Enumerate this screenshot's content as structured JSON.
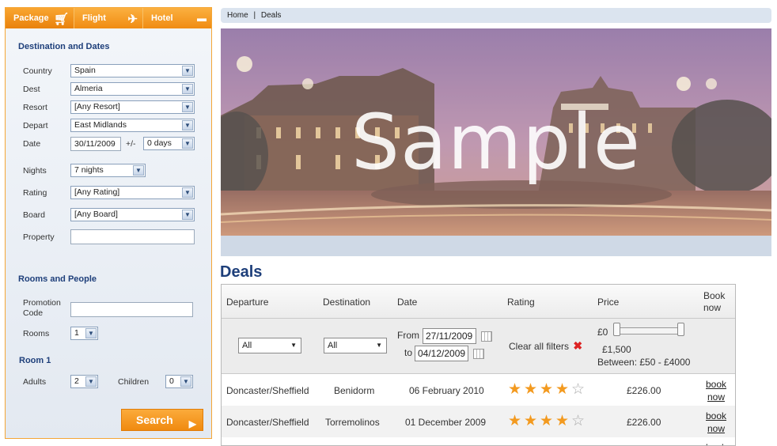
{
  "tabs": [
    {
      "label": "Package",
      "icon": "cart-icon"
    },
    {
      "label": "Flight",
      "icon": "plane-icon"
    },
    {
      "label": "Hotel",
      "icon": "bed-icon"
    }
  ],
  "search": {
    "section_dest": "Destination and Dates",
    "country_label": "Country",
    "country_value": "Spain",
    "dest_label": "Dest",
    "dest_value": "Almeria",
    "resort_label": "Resort",
    "resort_value": "[Any Resort]",
    "depart_label": "Depart",
    "depart_value": "East Midlands",
    "date_label": "Date",
    "date_value": "30/11/2009",
    "plusminus": "+/-",
    "flex_value": "0 days",
    "nights_label": "Nights",
    "nights_value": "7 nights",
    "rating_label": "Rating",
    "rating_value": "[Any Rating]",
    "board_label": "Board",
    "board_value": "[Any Board]",
    "property_label": "Property",
    "property_value": "",
    "section_rooms": "Rooms and People",
    "promo_label": "Promotion Code",
    "promo_value": "",
    "rooms_label": "Rooms",
    "rooms_value": "1",
    "room1_title": "Room 1",
    "adults_label": "Adults",
    "adults_value": "2",
    "children_label": "Children",
    "children_value": "0",
    "search_button": "Search"
  },
  "breadcrumb": {
    "home": "Home",
    "sep": "|",
    "current": "Deals"
  },
  "hero": {
    "watermark": "Sample"
  },
  "deals": {
    "title": "Deals",
    "columns": [
      "Departure",
      "Destination",
      "Date",
      "Rating",
      "Price",
      "Book now"
    ],
    "filters": {
      "departure": "All",
      "destination": "All",
      "from_label": "From",
      "from_value": "27/11/2009",
      "to_label": "to",
      "to_value": "04/12/2009",
      "clear_label": "Clear all filters",
      "price_min": "£0",
      "price_max": "£1,500",
      "price_between": "Between: £50 - £4000"
    },
    "rows": [
      {
        "departure": "Doncaster/Sheffield",
        "destination": "Benidorm",
        "date": "06 February 2010",
        "stars": 4,
        "price": "£226.00",
        "book1": "book",
        "book2": "now"
      },
      {
        "departure": "Doncaster/Sheffield",
        "destination": "Torremolinos",
        "date": "01 December 2009",
        "stars": 4,
        "price": "£226.00",
        "book1": "book",
        "book2": "now"
      },
      {
        "book1": "book"
      }
    ]
  },
  "colors": {
    "accent": "#f39a1f",
    "heading": "#1e3f7a",
    "star": "#f39a1f"
  }
}
